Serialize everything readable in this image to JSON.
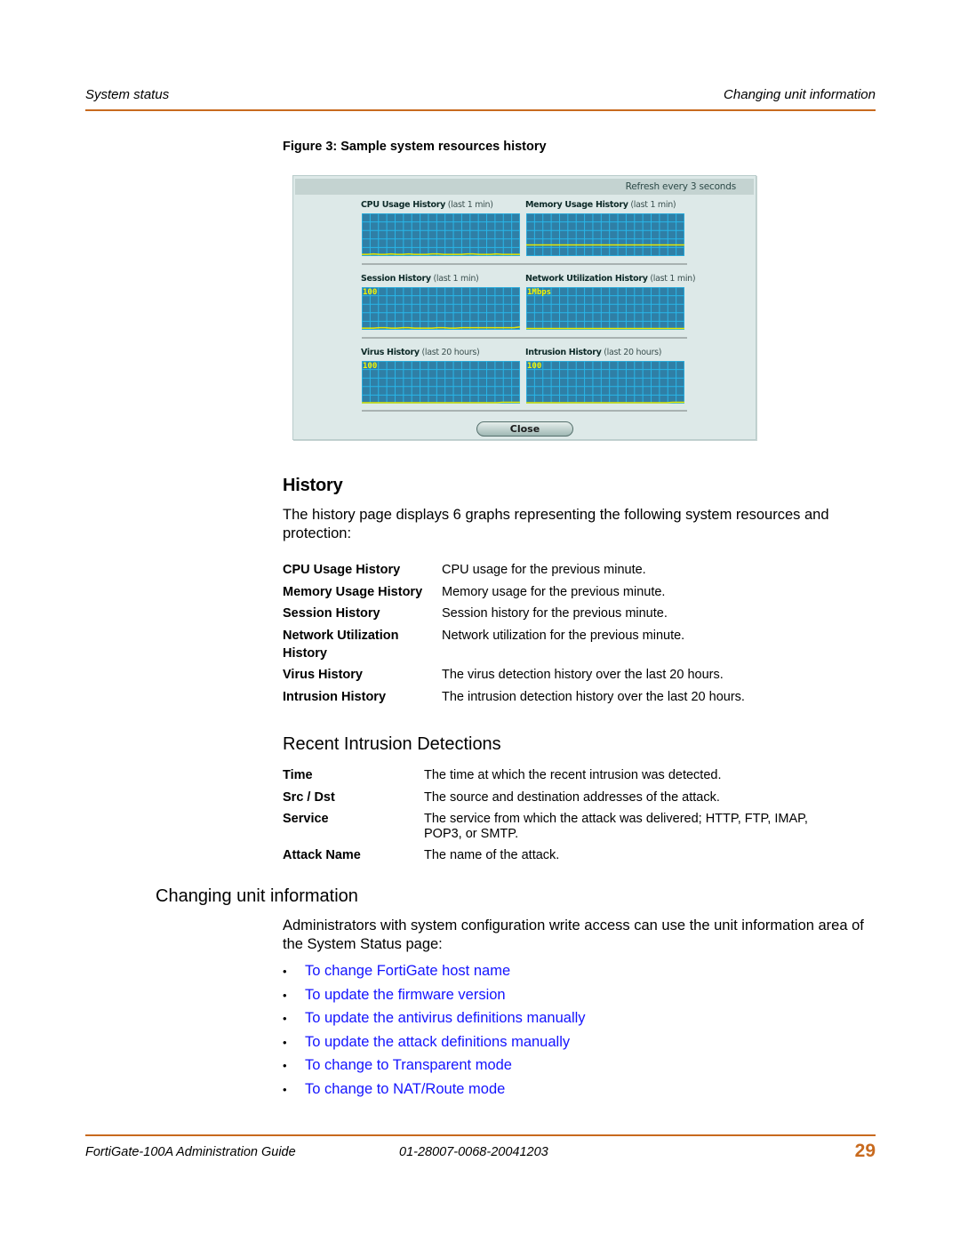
{
  "header": {
    "section": "System status",
    "topic": "Changing unit information"
  },
  "figure": {
    "caption": "Figure 3:  Sample system resources history",
    "panel": {
      "refresh_text": "Refresh every 3 seconds",
      "close_label": "Close",
      "colors": {
        "graph_bg": "#2f7fa6",
        "grid": "#29b6e8",
        "trace": "#e8e800",
        "label": "#f4f400"
      },
      "graphs": [
        {
          "title": "CPU Usage History",
          "period": "(last 1 min)",
          "scale_label": "",
          "trace": [
            2,
            2,
            3,
            2,
            2,
            3,
            2,
            2,
            3,
            2,
            2,
            2,
            3,
            3,
            2,
            2,
            2,
            2,
            3,
            3,
            2,
            2,
            2,
            3,
            2,
            2,
            2,
            2
          ]
        },
        {
          "title": "Memory Usage History",
          "period": "(last 1 min)",
          "scale_label": "",
          "trace": [
            25,
            25,
            25,
            25,
            25,
            25,
            25,
            25,
            25,
            25,
            25,
            25,
            25,
            25,
            25,
            25,
            25,
            25,
            25,
            25,
            25,
            25,
            25,
            25,
            25,
            25,
            25,
            25
          ]
        },
        {
          "title": "Session History",
          "period": "(last 1 min)",
          "scale_label": "100",
          "trace": [
            2,
            2,
            2,
            3,
            3,
            2,
            2,
            3,
            3,
            2,
            2,
            2,
            2,
            3,
            3,
            2,
            2,
            3,
            3,
            3,
            3,
            3,
            3,
            3,
            3,
            3,
            3,
            5
          ]
        },
        {
          "title": "Network Utilization History",
          "period": "(last 1 min)",
          "scale_label": "1Mbps",
          "trace": [
            1,
            1,
            1,
            1,
            1,
            1,
            1,
            1,
            1,
            1,
            1,
            1,
            1,
            1,
            1,
            1,
            1,
            1,
            1,
            1,
            1,
            1,
            1,
            1,
            1,
            1,
            1,
            1
          ]
        },
        {
          "title": "Virus History",
          "period": "(last 20 hours)",
          "scale_label": "100",
          "trace": [
            0,
            0,
            0,
            0,
            0,
            0,
            0,
            0,
            0,
            0,
            0,
            0,
            0,
            0,
            0,
            0,
            0,
            0,
            0,
            0,
            0,
            0,
            0,
            0,
            1,
            1,
            1,
            1
          ]
        },
        {
          "title": "Intrusion History",
          "period": "(last 20 hours)",
          "scale_label": "100",
          "trace": [
            0,
            0,
            0,
            0,
            0,
            0,
            0,
            0,
            0,
            0,
            0,
            0,
            0,
            0,
            0,
            0,
            0,
            0,
            0,
            0,
            0,
            0,
            0,
            0,
            0,
            1,
            1,
            1
          ]
        }
      ]
    }
  },
  "history": {
    "heading": "History",
    "intro": "The history page displays 6 graphs representing the following system resources and protection:",
    "definitions": [
      {
        "term": "CPU Usage History",
        "desc": "CPU usage for the previous minute."
      },
      {
        "term": "Memory Usage History",
        "desc": "Memory usage for the previous minute."
      },
      {
        "term": "Session History",
        "desc": "Session history for the previous minute."
      },
      {
        "term": "Network Utilization",
        "term2": "History",
        "desc": "Network utilization for the previous minute."
      },
      {
        "term": "Virus History",
        "desc": "The virus detection history over the last 20 hours."
      },
      {
        "term": "Intrusion History",
        "desc": "The intrusion detection history over the last 20 hours."
      }
    ]
  },
  "intrusions": {
    "heading": "Recent Intrusion Detections",
    "definitions": [
      {
        "term": "Time",
        "desc": "The time at which the recent intrusion was detected."
      },
      {
        "term": "Src / Dst",
        "desc": "The source and destination addresses of the attack."
      },
      {
        "term": "Service",
        "desc": "The service from which the attack was delivered; HTTP, FTP, IMAP,",
        "desc2": "POP3, or SMTP."
      },
      {
        "term": "Attack Name",
        "desc": "The name of the attack."
      }
    ]
  },
  "unit_info": {
    "heading": "Changing unit information",
    "intro": "Administrators with system configuration write access can use the unit information area of the System Status page:",
    "bullet": "•",
    "links": [
      "To change FortiGate host name",
      "To update the firmware version",
      "To update the antivirus definitions manually",
      "To update the attack definitions manually",
      "To change to Transparent mode",
      "To change to NAT/Route mode"
    ],
    "link_color": "#1414ff"
  },
  "footer": {
    "guide": "FortiGate-100A Administration Guide",
    "doc_number": "01-28007-0068-20041203",
    "page": "29"
  }
}
